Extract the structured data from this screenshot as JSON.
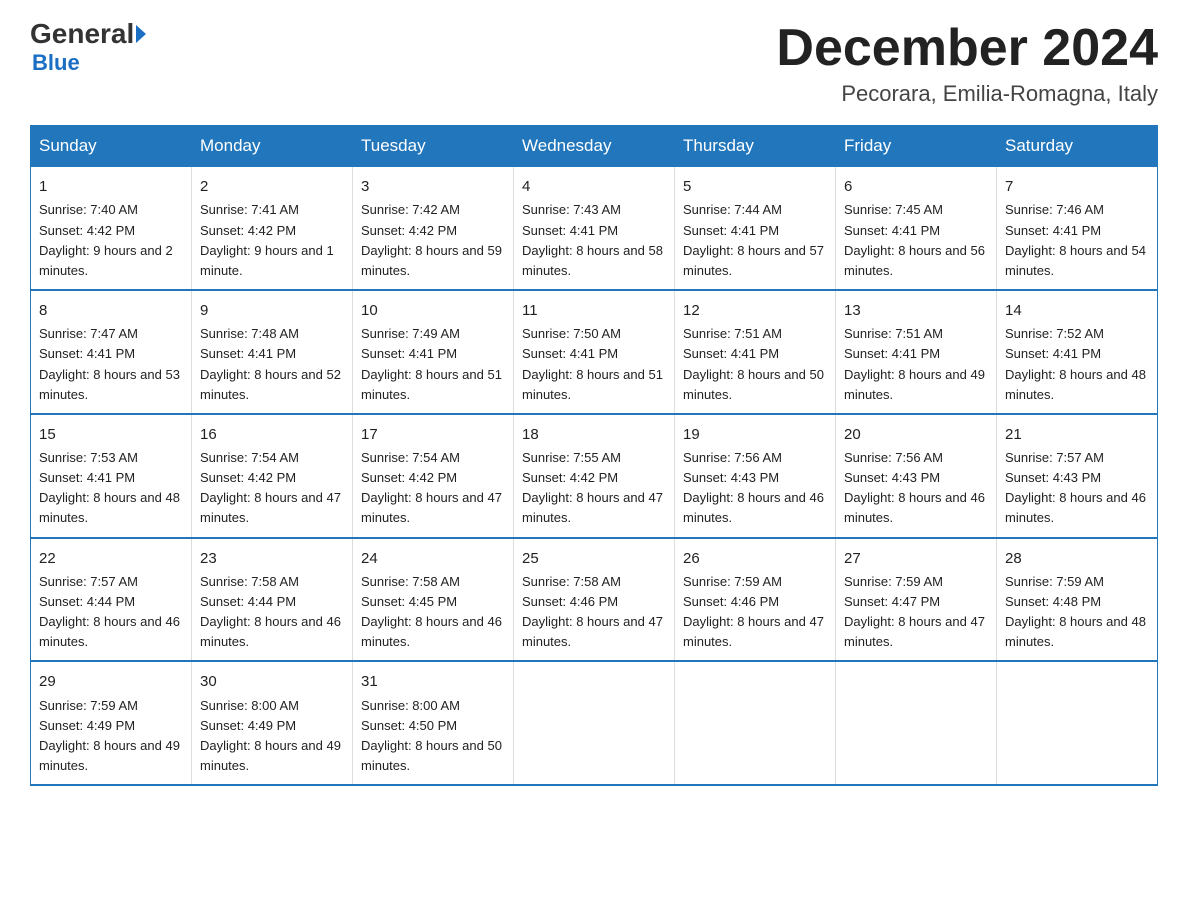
{
  "logo": {
    "general": "General",
    "blue": "Blue"
  },
  "title": "December 2024",
  "subtitle": "Pecorara, Emilia-Romagna, Italy",
  "days_of_week": [
    "Sunday",
    "Monday",
    "Tuesday",
    "Wednesday",
    "Thursday",
    "Friday",
    "Saturday"
  ],
  "weeks": [
    [
      {
        "day": "1",
        "sunrise": "Sunrise: 7:40 AM",
        "sunset": "Sunset: 4:42 PM",
        "daylight": "Daylight: 9 hours and 2 minutes."
      },
      {
        "day": "2",
        "sunrise": "Sunrise: 7:41 AM",
        "sunset": "Sunset: 4:42 PM",
        "daylight": "Daylight: 9 hours and 1 minute."
      },
      {
        "day": "3",
        "sunrise": "Sunrise: 7:42 AM",
        "sunset": "Sunset: 4:42 PM",
        "daylight": "Daylight: 8 hours and 59 minutes."
      },
      {
        "day": "4",
        "sunrise": "Sunrise: 7:43 AM",
        "sunset": "Sunset: 4:41 PM",
        "daylight": "Daylight: 8 hours and 58 minutes."
      },
      {
        "day": "5",
        "sunrise": "Sunrise: 7:44 AM",
        "sunset": "Sunset: 4:41 PM",
        "daylight": "Daylight: 8 hours and 57 minutes."
      },
      {
        "day": "6",
        "sunrise": "Sunrise: 7:45 AM",
        "sunset": "Sunset: 4:41 PM",
        "daylight": "Daylight: 8 hours and 56 minutes."
      },
      {
        "day": "7",
        "sunrise": "Sunrise: 7:46 AM",
        "sunset": "Sunset: 4:41 PM",
        "daylight": "Daylight: 8 hours and 54 minutes."
      }
    ],
    [
      {
        "day": "8",
        "sunrise": "Sunrise: 7:47 AM",
        "sunset": "Sunset: 4:41 PM",
        "daylight": "Daylight: 8 hours and 53 minutes."
      },
      {
        "day": "9",
        "sunrise": "Sunrise: 7:48 AM",
        "sunset": "Sunset: 4:41 PM",
        "daylight": "Daylight: 8 hours and 52 minutes."
      },
      {
        "day": "10",
        "sunrise": "Sunrise: 7:49 AM",
        "sunset": "Sunset: 4:41 PM",
        "daylight": "Daylight: 8 hours and 51 minutes."
      },
      {
        "day": "11",
        "sunrise": "Sunrise: 7:50 AM",
        "sunset": "Sunset: 4:41 PM",
        "daylight": "Daylight: 8 hours and 51 minutes."
      },
      {
        "day": "12",
        "sunrise": "Sunrise: 7:51 AM",
        "sunset": "Sunset: 4:41 PM",
        "daylight": "Daylight: 8 hours and 50 minutes."
      },
      {
        "day": "13",
        "sunrise": "Sunrise: 7:51 AM",
        "sunset": "Sunset: 4:41 PM",
        "daylight": "Daylight: 8 hours and 49 minutes."
      },
      {
        "day": "14",
        "sunrise": "Sunrise: 7:52 AM",
        "sunset": "Sunset: 4:41 PM",
        "daylight": "Daylight: 8 hours and 48 minutes."
      }
    ],
    [
      {
        "day": "15",
        "sunrise": "Sunrise: 7:53 AM",
        "sunset": "Sunset: 4:41 PM",
        "daylight": "Daylight: 8 hours and 48 minutes."
      },
      {
        "day": "16",
        "sunrise": "Sunrise: 7:54 AM",
        "sunset": "Sunset: 4:42 PM",
        "daylight": "Daylight: 8 hours and 47 minutes."
      },
      {
        "day": "17",
        "sunrise": "Sunrise: 7:54 AM",
        "sunset": "Sunset: 4:42 PM",
        "daylight": "Daylight: 8 hours and 47 minutes."
      },
      {
        "day": "18",
        "sunrise": "Sunrise: 7:55 AM",
        "sunset": "Sunset: 4:42 PM",
        "daylight": "Daylight: 8 hours and 47 minutes."
      },
      {
        "day": "19",
        "sunrise": "Sunrise: 7:56 AM",
        "sunset": "Sunset: 4:43 PM",
        "daylight": "Daylight: 8 hours and 46 minutes."
      },
      {
        "day": "20",
        "sunrise": "Sunrise: 7:56 AM",
        "sunset": "Sunset: 4:43 PM",
        "daylight": "Daylight: 8 hours and 46 minutes."
      },
      {
        "day": "21",
        "sunrise": "Sunrise: 7:57 AM",
        "sunset": "Sunset: 4:43 PM",
        "daylight": "Daylight: 8 hours and 46 minutes."
      }
    ],
    [
      {
        "day": "22",
        "sunrise": "Sunrise: 7:57 AM",
        "sunset": "Sunset: 4:44 PM",
        "daylight": "Daylight: 8 hours and 46 minutes."
      },
      {
        "day": "23",
        "sunrise": "Sunrise: 7:58 AM",
        "sunset": "Sunset: 4:44 PM",
        "daylight": "Daylight: 8 hours and 46 minutes."
      },
      {
        "day": "24",
        "sunrise": "Sunrise: 7:58 AM",
        "sunset": "Sunset: 4:45 PM",
        "daylight": "Daylight: 8 hours and 46 minutes."
      },
      {
        "day": "25",
        "sunrise": "Sunrise: 7:58 AM",
        "sunset": "Sunset: 4:46 PM",
        "daylight": "Daylight: 8 hours and 47 minutes."
      },
      {
        "day": "26",
        "sunrise": "Sunrise: 7:59 AM",
        "sunset": "Sunset: 4:46 PM",
        "daylight": "Daylight: 8 hours and 47 minutes."
      },
      {
        "day": "27",
        "sunrise": "Sunrise: 7:59 AM",
        "sunset": "Sunset: 4:47 PM",
        "daylight": "Daylight: 8 hours and 47 minutes."
      },
      {
        "day": "28",
        "sunrise": "Sunrise: 7:59 AM",
        "sunset": "Sunset: 4:48 PM",
        "daylight": "Daylight: 8 hours and 48 minutes."
      }
    ],
    [
      {
        "day": "29",
        "sunrise": "Sunrise: 7:59 AM",
        "sunset": "Sunset: 4:49 PM",
        "daylight": "Daylight: 8 hours and 49 minutes."
      },
      {
        "day": "30",
        "sunrise": "Sunrise: 8:00 AM",
        "sunset": "Sunset: 4:49 PM",
        "daylight": "Daylight: 8 hours and 49 minutes."
      },
      {
        "day": "31",
        "sunrise": "Sunrise: 8:00 AM",
        "sunset": "Sunset: 4:50 PM",
        "daylight": "Daylight: 8 hours and 50 minutes."
      },
      null,
      null,
      null,
      null
    ]
  ]
}
